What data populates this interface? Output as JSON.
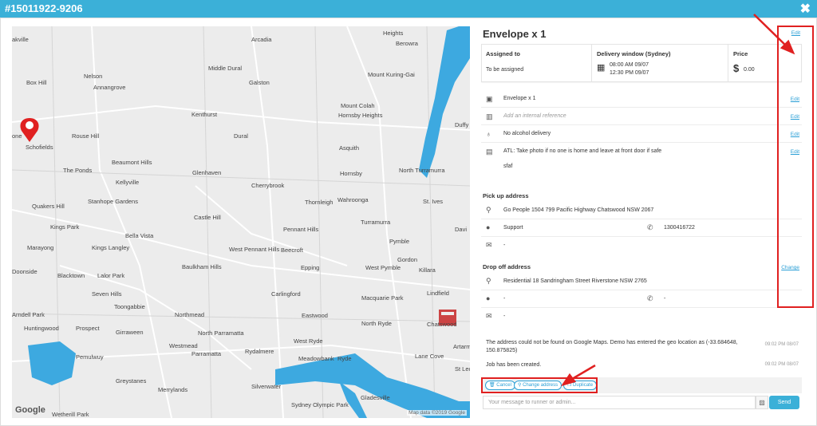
{
  "header": {
    "title": "#15011922-9206",
    "close_label": "✖"
  },
  "map": {
    "labels": [
      {
        "t": "akville"
      },
      {
        "t": "Arcadia"
      },
      {
        "t": "Berowra"
      },
      {
        "t": "Box Hill"
      },
      {
        "t": "Nelson"
      },
      {
        "t": "Middle Dural"
      },
      {
        "t": "Annangrove"
      },
      {
        "t": "Galston"
      },
      {
        "t": "Mount Kuring-Gai"
      },
      {
        "t": "Kenthurst"
      },
      {
        "t": "Mount Colah"
      },
      {
        "t": "Hornsby Heights"
      },
      {
        "t": "Duffy"
      },
      {
        "t": "one"
      },
      {
        "t": "Rouse Hill"
      },
      {
        "t": "Dural"
      },
      {
        "t": "Asquith"
      },
      {
        "t": "Schofields"
      },
      {
        "t": "The Ponds"
      },
      {
        "t": "Beaumont Hills"
      },
      {
        "t": "Kellyville"
      },
      {
        "t": "Glenhaven"
      },
      {
        "t": "Hornsby"
      },
      {
        "t": "North Turramurra"
      },
      {
        "t": "Stanhope Gardens"
      },
      {
        "t": "Quakers Hill"
      },
      {
        "t": "Cherrybrook"
      },
      {
        "t": "Thornleigh"
      },
      {
        "t": "Wahroonga"
      },
      {
        "t": "St. Ives"
      },
      {
        "t": "Castle Hill"
      },
      {
        "t": "Kings Park"
      },
      {
        "t": "Bella Vista"
      },
      {
        "t": "Pennant Hills"
      },
      {
        "t": "Turramurra"
      },
      {
        "t": "Davi"
      },
      {
        "t": "Marayong"
      },
      {
        "t": "Kings Langley"
      },
      {
        "t": "West Pennant Hills"
      },
      {
        "t": "Beecroft"
      },
      {
        "t": "Pymble"
      },
      {
        "t": "Gordon"
      },
      {
        "t": "Baulkham Hills"
      },
      {
        "t": "West Pymble"
      },
      {
        "t": "Doonside"
      },
      {
        "t": "Blacktown"
      },
      {
        "t": "Lalor Park"
      },
      {
        "t": "Epping"
      },
      {
        "t": "Killara"
      },
      {
        "t": "Seven Hills"
      },
      {
        "t": "Carlingford"
      },
      {
        "t": "Macquarie Park"
      },
      {
        "t": "Lindfield"
      },
      {
        "t": "Toongabbie"
      },
      {
        "t": "Arndell Park"
      },
      {
        "t": "Northmead"
      },
      {
        "t": "Eastwood"
      },
      {
        "t": "North Ryde"
      },
      {
        "t": "Chatswood"
      },
      {
        "t": "Huntingwood"
      },
      {
        "t": "Prospect"
      },
      {
        "t": "Girraween"
      },
      {
        "t": "North Parramatta"
      },
      {
        "t": "Artarmon"
      },
      {
        "t": "Westmead"
      },
      {
        "t": "West Ryde"
      },
      {
        "t": "Pemulwuy"
      },
      {
        "t": "Parramatta"
      },
      {
        "t": "Rydalmere"
      },
      {
        "t": "Meadowbank"
      },
      {
        "t": "Ryde"
      },
      {
        "t": "Lane Cove"
      },
      {
        "t": "St Leo"
      },
      {
        "t": "Greystanes"
      },
      {
        "t": "Merrylands"
      },
      {
        "t": "Silverwater"
      },
      {
        "t": "Gladesville"
      },
      {
        "t": "Wetherill Park"
      },
      {
        "t": "Sydney Olympic Park"
      },
      {
        "t": "Heights"
      }
    ],
    "google_label": "Google",
    "map_data_label": "Map data ©2019 Google"
  },
  "job": {
    "title": "Envelope x 1",
    "edit_label": "Edit",
    "assigned_header": "Assigned to",
    "assigned_value": "To be assigned",
    "window_header": "Delivery window (Sydney)",
    "window_start": "08:00 AM 09/07",
    "window_end": "12:30 PM 09/07",
    "price_header": "Price",
    "price_value": "0.00"
  },
  "details": [
    {
      "text": "Envelope x 1",
      "edit": "Edit",
      "italic": false
    },
    {
      "text": "Add an internal reference",
      "edit": "Edit",
      "italic": true
    },
    {
      "text": "No alcohol delivery",
      "edit": "Edit",
      "italic": false
    },
    {
      "text": "ATL: Take photo if no one is home and leave at front door if safe",
      "edit": "Edit",
      "italic": false
    }
  ],
  "details_note": "sfaf",
  "pickup": {
    "header": "Pick up address",
    "address": "Go People 1504 799 Pacific Highway Chatswood NSW 2067",
    "contact": "Support",
    "phone": "1300416722",
    "email": "-"
  },
  "dropoff": {
    "header": "Drop off address",
    "change_label": "Change",
    "address": "Residential 18 Sandringham Street Riverstone NSW 2765",
    "contact": "-",
    "phone": "-",
    "email": "-"
  },
  "messages": [
    {
      "text": "The address could not be found on Google Maps. Demo has entered the geo location as (-33.684648, 150.875825)",
      "time": "09:02 PM 08/07"
    },
    {
      "text": "Job has been created.",
      "time": "09:02 PM 08/07"
    }
  ],
  "actions": {
    "cancel": "Cancel",
    "change_address": "Change address",
    "duplicate": "Duplicate"
  },
  "compose": {
    "placeholder": "Your message to runner or admin...",
    "send": "Send"
  },
  "colors": {
    "accent": "#3bb0d8",
    "link": "#2a9fd6",
    "water": "#3da9e0",
    "annotation": "#e02020"
  }
}
